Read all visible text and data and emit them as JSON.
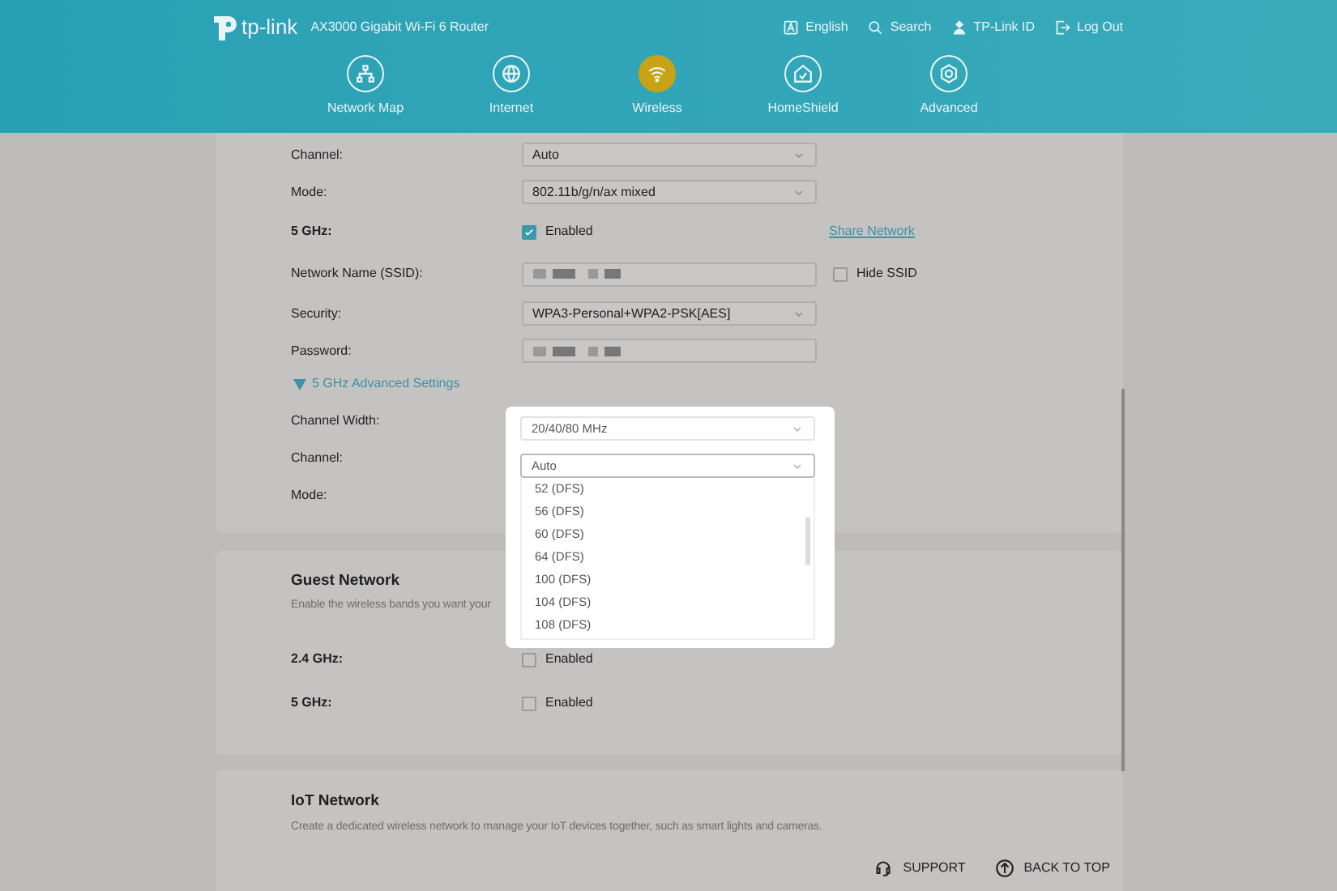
{
  "header": {
    "brand": "tp-link",
    "model": "AX3000 Gigabit Wi-Fi 6 Router",
    "links": [
      {
        "kind": "language",
        "label": "English"
      },
      {
        "kind": "search",
        "label": "Search"
      },
      {
        "kind": "account",
        "label": "TP-Link ID"
      },
      {
        "kind": "logout",
        "label": "Log Out"
      }
    ]
  },
  "nav": [
    {
      "kind": "map",
      "label": "Network Map",
      "selected": false
    },
    {
      "kind": "globe",
      "label": "Internet",
      "selected": false
    },
    {
      "kind": "wifi",
      "label": "Wireless",
      "selected": true
    },
    {
      "kind": "shield",
      "label": "HomeShield",
      "selected": false
    },
    {
      "kind": "gear",
      "label": "Advanced",
      "selected": false
    }
  ],
  "wireless_card": {
    "rows": [
      {
        "kind": "select",
        "label": "Channel:",
        "value": "Auto"
      },
      {
        "kind": "select",
        "label": "Mode:",
        "value": "802.11b/g/n/ax mixed"
      },
      {
        "kind": "checkbox",
        "label": "5 GHz:",
        "checked": true,
        "text": "Enabled",
        "link": "Share Network"
      },
      {
        "kind": "hidden",
        "label": "Network Name (SSID):",
        "option": {
          "checked": false,
          "text": "Hide SSID"
        }
      },
      {
        "kind": "select",
        "label": "Security:",
        "value": "WPA3-Personal+WPA2-PSK[AES]"
      },
      {
        "kind": "hidden",
        "label": "Password:"
      }
    ],
    "advanced": {
      "label": "5 GHz Advanced Settings",
      "expanded": true,
      "rows": [
        "Channel Width:",
        "Channel:",
        "Mode:"
      ]
    }
  },
  "popup": {
    "selects": [
      {
        "value": "20/40/80 MHz",
        "open": false
      },
      {
        "value": "Auto",
        "open": true
      }
    ],
    "options": [
      "52 (DFS)",
      "56 (DFS)",
      "60 (DFS)",
      "64 (DFS)",
      "100 (DFS)",
      "104 (DFS)",
      "108 (DFS)"
    ]
  },
  "guest_card": {
    "title": "Guest Network",
    "description": "Enable the wireless bands you want your",
    "rows": [
      {
        "label": "2.4 GHz:",
        "checked": false,
        "text": "Enabled"
      },
      {
        "label": "5 GHz:",
        "checked": false,
        "text": "Enabled"
      }
    ]
  },
  "iot_card": {
    "title": "IoT Network",
    "description": "Create a dedicated wireless network to manage your IoT devices together, such as smart lights and cameras."
  },
  "footer": [
    {
      "kind": "support",
      "label": "SUPPORT"
    },
    {
      "kind": "top",
      "label": "BACK TO TOP"
    }
  ]
}
